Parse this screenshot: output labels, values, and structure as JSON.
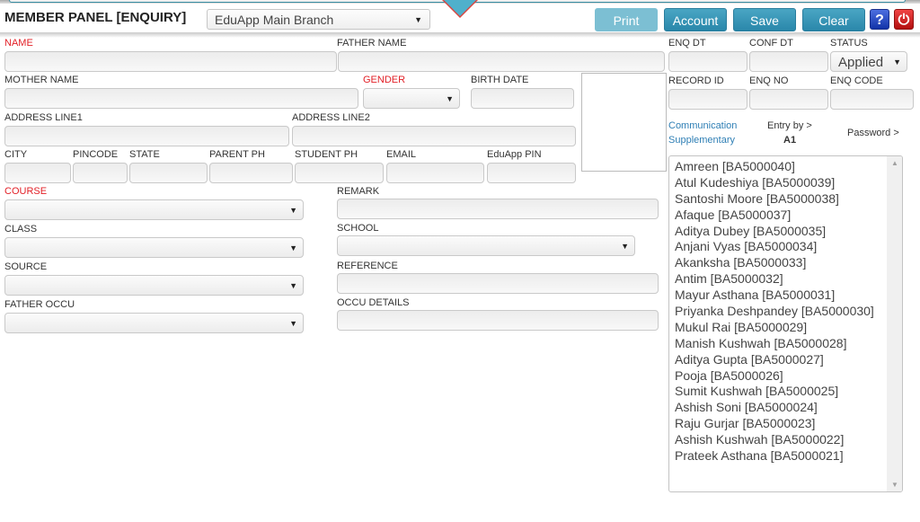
{
  "header": {
    "title": "MEMBER PANEL [ENQUIRY]",
    "branch_selected": "EduApp Main Branch",
    "buttons": {
      "print": "Print",
      "account": "Account",
      "save": "Save",
      "clear": "Clear",
      "help": "?",
      "power": "⏻"
    }
  },
  "form": {
    "name": {
      "label": "NAME",
      "value": ""
    },
    "father_name": {
      "label": "FATHER NAME",
      "value": ""
    },
    "mother_name": {
      "label": "MOTHER NAME",
      "value": ""
    },
    "gender": {
      "label": "GENDER",
      "value": ""
    },
    "birth_date": {
      "label": "BIRTH DATE",
      "value": ""
    },
    "address_line1": {
      "label": "ADDRESS LINE1",
      "value": ""
    },
    "address_line2": {
      "label": "ADDRESS LINE2",
      "value": ""
    },
    "city": {
      "label": "CITY",
      "value": ""
    },
    "pincode": {
      "label": "PINCODE",
      "value": ""
    },
    "state": {
      "label": "STATE",
      "value": ""
    },
    "parent_ph": {
      "label": "PARENT PH",
      "value": ""
    },
    "student_ph": {
      "label": "STUDENT PH",
      "value": ""
    },
    "email": {
      "label": "EMAIL",
      "value": ""
    },
    "eduapp_pin": {
      "label": "EduApp PIN",
      "value": ""
    },
    "course": {
      "label": "COURSE",
      "value": ""
    },
    "remark": {
      "label": "REMARK",
      "value": ""
    },
    "class": {
      "label": "CLASS",
      "value": ""
    },
    "school": {
      "label": "SCHOOL",
      "value": ""
    },
    "source": {
      "label": "SOURCE",
      "value": ""
    },
    "reference": {
      "label": "REFERENCE",
      "value": ""
    },
    "father_occu": {
      "label": "FATHER OCCU",
      "value": ""
    },
    "occu_details": {
      "label": "OCCU DETAILS",
      "value": ""
    }
  },
  "sidepanel": {
    "enq_dt": {
      "label": "ENQ DT",
      "value": ""
    },
    "conf_dt": {
      "label": "CONF DT",
      "value": ""
    },
    "status": {
      "label": "STATUS",
      "value": "Applied"
    },
    "record_id": {
      "label": "RECORD ID",
      "value": ""
    },
    "enq_no": {
      "label": "ENQ NO",
      "value": ""
    },
    "enq_code": {
      "label": "ENQ CODE",
      "value": ""
    },
    "links": {
      "communication": "Communication",
      "supplementary": "Supplementary"
    },
    "entry_by_label": "Entry by >",
    "entry_by_value": "A1",
    "password_label": "Password >"
  },
  "enquiry_list": [
    "Amreen [BA5000040]",
    "Atul Kudeshiya [BA5000039]",
    "Santoshi Moore [BA5000038]",
    "Afaque [BA5000037]",
    "Aditya Dubey [BA5000035]",
    "Anjani Vyas [BA5000034]",
    "Akanksha [BA5000033]",
    "Antim [BA5000032]",
    "Mayur Asthana [BA5000031]",
    "Priyanka Deshpandey [BA5000030]",
    "Mukul Rai [BA5000029]",
    "Manish Kushwah [BA5000028]",
    "Aditya Gupta [BA5000027]",
    "Pooja [BA5000026]",
    "Sumit Kushwah [BA5000025]",
    "Ashish Soni [BA5000024]",
    "Raju Gurjar [BA5000023]",
    "Ashish Kushwah [BA5000022]",
    "Prateek Asthana [BA5000021]"
  ]
}
